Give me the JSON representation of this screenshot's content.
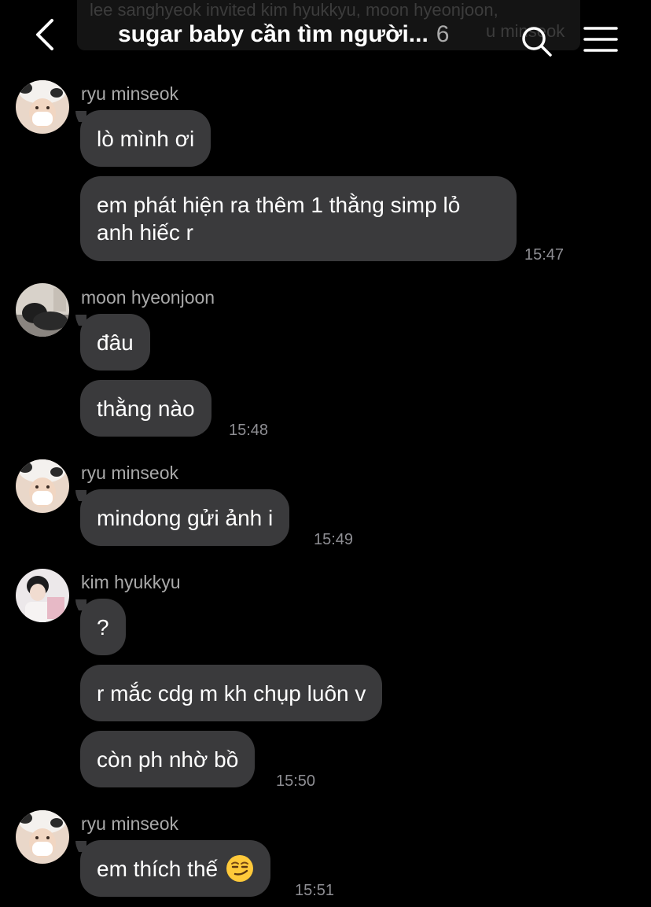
{
  "header": {
    "system_message_line1": "lee sanghyeok invited kim hyukkyu, moon hyeonjoon,",
    "system_message_line2": "u minseok",
    "title": "sugar baby cần tìm người...",
    "member_count": "6",
    "icons": [
      "chevron-left-icon",
      "search-icon",
      "hamburger-menu-icon"
    ]
  },
  "colors": {
    "background": "#000000",
    "bubble": "#3a3a3c",
    "sender_name": "#a9a9a9",
    "timestamp": "#8e8e93"
  },
  "messages": [
    {
      "sender": "ryu minseok",
      "bubbles": [
        "lò mình ơi",
        "em phát hiện ra thêm 1 thằng simp lỏ anh hiếc r"
      ],
      "time": "15:47"
    },
    {
      "sender": "moon hyeonjoon",
      "bubbles": [
        "đâu",
        "thằng nào"
      ],
      "time": "15:48"
    },
    {
      "sender": "ryu minseok",
      "bubbles": [
        "mindong gửi ảnh i"
      ],
      "time": "15:49"
    },
    {
      "sender": "kim hyukkyu",
      "bubbles": [
        "?",
        "r mắc cdg m kh chụp luôn v",
        "còn ph nhờ bồ"
      ],
      "time": "15:50"
    },
    {
      "sender": "ryu minseok",
      "bubbles": [
        "em thích thế"
      ],
      "bubble_emoji": "smirking-face-emoji",
      "time": "15:51"
    }
  ]
}
